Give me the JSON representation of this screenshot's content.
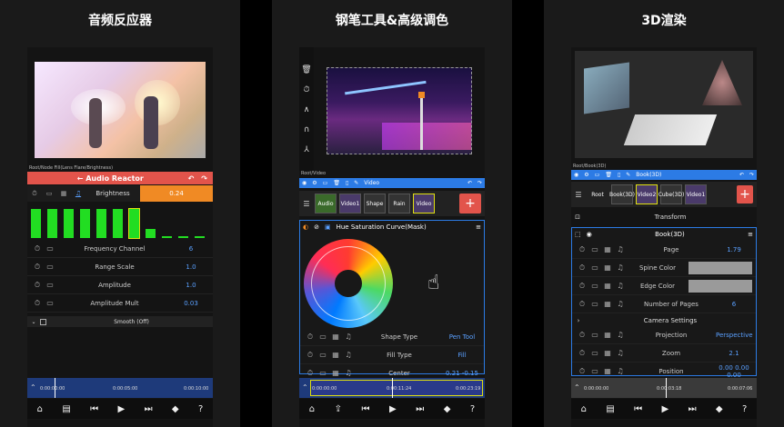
{
  "panel1": {
    "title": "音频反应器",
    "breadcrumb": "Root/Node Fill(Lens Flare/Brightness)",
    "header": "Audio Reactor",
    "back_icon": "←",
    "undo_icon": "↶",
    "redo_icon": "↷",
    "brightness_label": "Brightness",
    "brightness_value": "0.24",
    "bars": [
      0.85,
      0.85,
      0.85,
      0.85,
      0.85,
      0.85,
      0.85,
      0.25,
      0.06,
      0.06,
      0.06
    ],
    "rows": [
      {
        "label": "Frequency Channel",
        "value": "6"
      },
      {
        "label": "Range Scale",
        "value": "1.0"
      },
      {
        "label": "Amplitude",
        "value": "1.0"
      },
      {
        "label": "Amplitude Mult",
        "value": "0.03"
      }
    ],
    "smooth": "Smooth (Off)",
    "time_start": "0:00:00:00",
    "time_mid": "0:00:05:00",
    "time_end": "0:00:10:00"
  },
  "panel2": {
    "title": "钢笔工具&高级调色",
    "breadcrumb": "Root/Video",
    "video_label": "Video",
    "thumbs": [
      "Audio",
      "Video1",
      "Shape",
      "Rain",
      "Video"
    ],
    "effect_title": "Hue Saturation Curve(Mask)",
    "rows": [
      {
        "label": "Shape Type",
        "value": "Pen Tool"
      },
      {
        "label": "Fill Type",
        "value": "Fill"
      },
      {
        "label": "Center",
        "value": "0.21   -0.15"
      }
    ],
    "time_start": "0:00:00:00",
    "time_mid": "0:00:11:24",
    "time_end": "0:00:23:19"
  },
  "panel3": {
    "title": "3D渲染",
    "breadcrumb": "Root/Book(3D)",
    "node_label": "Book(3D)",
    "root_label": "Root",
    "thumbs": [
      "Book(3D)",
      "Video2",
      "Cube(3D)",
      "Video1"
    ],
    "transform": "Transform",
    "section": "Book(3D)",
    "rows": [
      {
        "label": "Page",
        "value": "1.79"
      },
      {
        "label": "Spine Color",
        "value": ""
      },
      {
        "label": "Edge Color",
        "value": ""
      },
      {
        "label": "Number of Pages",
        "value": "6"
      }
    ],
    "camera": "Camera Settings",
    "rows2": [
      {
        "label": "Projection",
        "value": "Perspective"
      },
      {
        "label": "Zoom",
        "value": "2.1"
      },
      {
        "label": "Position",
        "value": "0.00   0.00   0.00"
      }
    ],
    "time_start": "0:00:00:00",
    "time_mid": "0:00:03:18",
    "time_end": "0:00:07:06"
  },
  "colors": {
    "accent": "#2c7be5",
    "red": "#e2544b",
    "orange": "#f08a24",
    "green": "#22dd22"
  }
}
